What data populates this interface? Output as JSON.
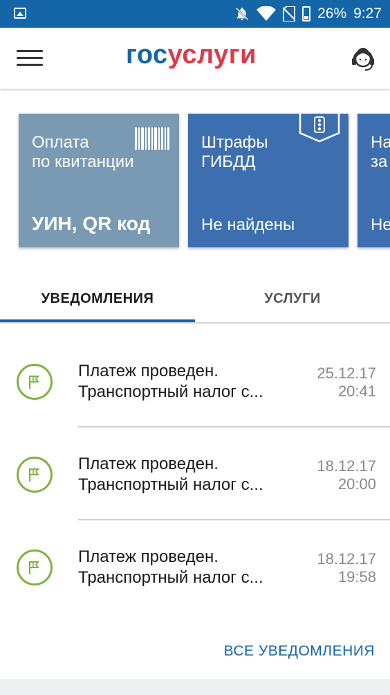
{
  "status_bar": {
    "battery": "26%",
    "time": "9:27"
  },
  "header": {
    "logo_part1": "гос",
    "logo_part2": "услуги"
  },
  "cards": [
    {
      "title": "Оплата\nпо квитанции",
      "value": "УИН, QR код",
      "icon": "barcode-icon"
    },
    {
      "title": "Штрафы\nГИБДД",
      "value": "Не найдены",
      "icon": "traffic-light-icon"
    },
    {
      "title": "На\nза",
      "value": "Не"
    }
  ],
  "tabs": [
    {
      "label": "УВЕДОМЛЕНИЯ",
      "active": true
    },
    {
      "label": "УСЛУГИ",
      "active": false
    }
  ],
  "notifications": [
    {
      "title": "Платеж проведен.",
      "subtitle": "Транспортный налог с...",
      "date": "25.12.17",
      "time": "20:41",
      "icon": "flag-icon"
    },
    {
      "title": "Платеж проведен.",
      "subtitle": "Транспортный налог с...",
      "date": "18.12.17",
      "time": "20:00",
      "icon": "flag-icon"
    },
    {
      "title": "Платеж проведен.",
      "subtitle": "Транспортный налог с...",
      "date": "18.12.17",
      "time": "19:58",
      "icon": "flag-icon"
    }
  ],
  "all_notifications_label": "ВСЕ УВЕДОМЛЕНИЯ",
  "colors": {
    "brand_blue": "#1565a9",
    "brand_red": "#e0394a",
    "card_gray": "#7a9ab4",
    "card_blue": "#3d6fb0",
    "icon_green": "#7bb441"
  }
}
